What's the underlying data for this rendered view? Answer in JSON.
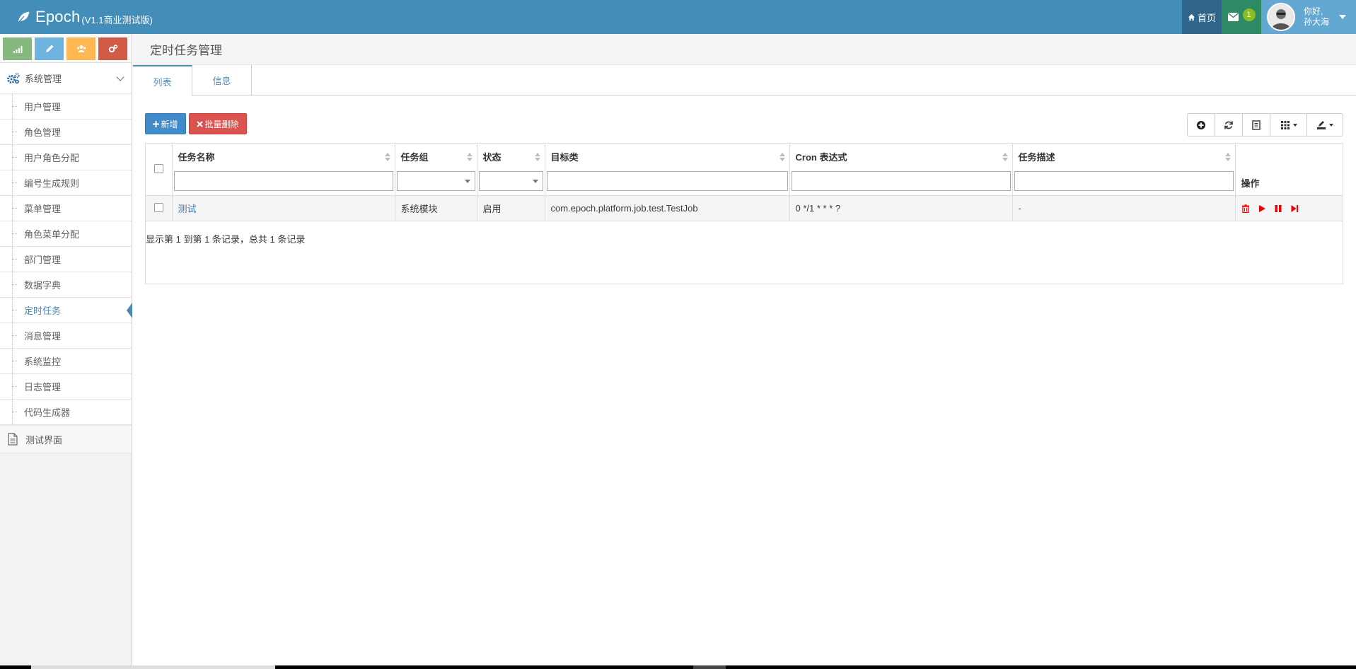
{
  "app": {
    "name": "Epoch",
    "version": "(V1.1商业测试版)"
  },
  "nav": {
    "home_label": "首页",
    "msg_count": "1",
    "greeting": "你好,",
    "user_name": "孙大海"
  },
  "sidebar": {
    "group_label": "系统管理",
    "items": [
      {
        "label": "用户管理"
      },
      {
        "label": "角色管理"
      },
      {
        "label": "用户角色分配"
      },
      {
        "label": "编号生成规则"
      },
      {
        "label": "菜单管理"
      },
      {
        "label": "角色菜单分配"
      },
      {
        "label": "部门管理"
      },
      {
        "label": "数据字典"
      },
      {
        "label": "定时任务"
      },
      {
        "label": "消息管理"
      },
      {
        "label": "系统监控"
      },
      {
        "label": "日志管理"
      },
      {
        "label": "代码生成器"
      }
    ],
    "active_item": "定时任务",
    "test_label": "测试界面"
  },
  "page": {
    "title": "定时任务管理",
    "tabs": [
      {
        "label": "列表"
      },
      {
        "label": "信息"
      }
    ]
  },
  "toolbar": {
    "add_label": "新增",
    "batch_delete_label": "批量删除"
  },
  "table": {
    "columns": [
      {
        "label": "任务名称"
      },
      {
        "label": "任务组"
      },
      {
        "label": "状态"
      },
      {
        "label": "目标类"
      },
      {
        "label": "Cron 表达式"
      },
      {
        "label": "任务描述"
      },
      {
        "label": "操作"
      }
    ],
    "rows": [
      {
        "name": "测试",
        "group": "系统模块",
        "status": "启用",
        "target_class": "com.epoch.platform.job.test.TestJob",
        "cron": "0 */1 * * * ?",
        "description": "-"
      }
    ],
    "pagination_info": "显示第 1 到第 1 条记录，总共 1 条记录"
  },
  "colors": {
    "navbar": "#438eb9",
    "primary": "#428bca",
    "danger": "#d9534f",
    "op_icon": "#e00000"
  }
}
